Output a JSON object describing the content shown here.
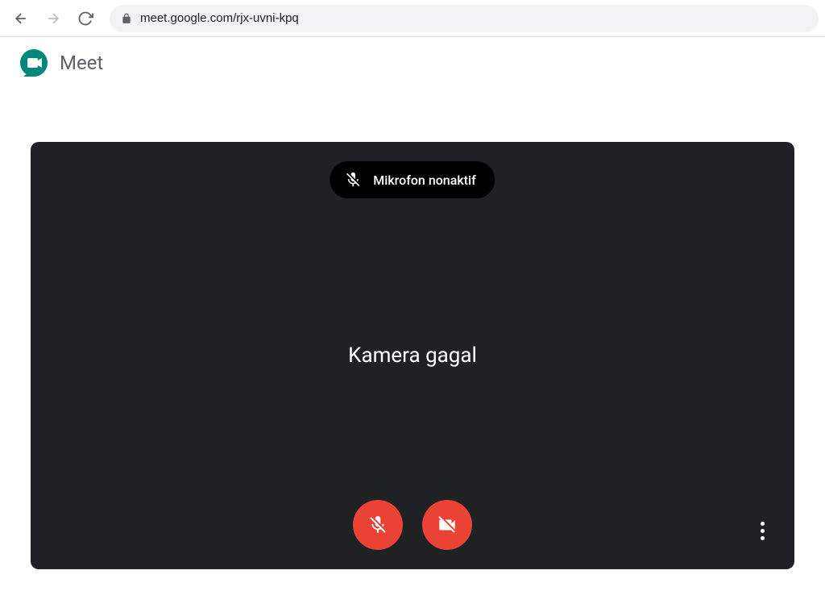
{
  "browser": {
    "url": "meet.google.com/rjx-uvni-kpq"
  },
  "header": {
    "title": "Meet"
  },
  "video": {
    "mic_notice": "Mikrofon nonaktif",
    "camera_status": "Kamera gagal"
  },
  "colors": {
    "danger": "#ea4335",
    "brand": "#00897b"
  }
}
